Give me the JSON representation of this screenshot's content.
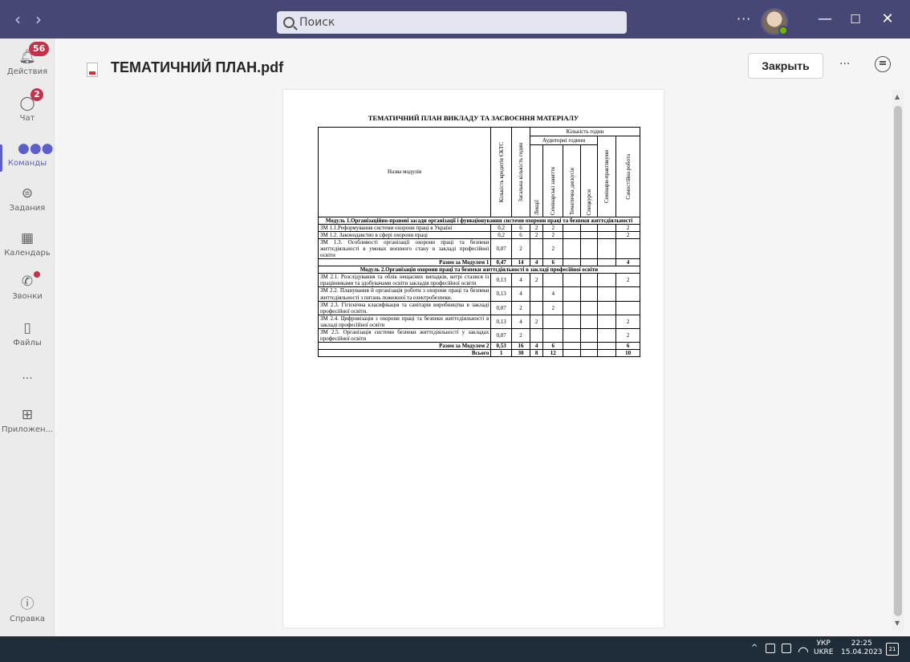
{
  "search": {
    "placeholder": "Поиск"
  },
  "rail": [
    {
      "label": "Действия",
      "badge": "56"
    },
    {
      "label": "Чат",
      "badge": "2"
    },
    {
      "label": "Команды"
    },
    {
      "label": "Задания"
    },
    {
      "label": "Календарь"
    },
    {
      "label": "Звонки"
    },
    {
      "label": "Файлы"
    },
    {
      "label": "..."
    },
    {
      "label": "Приложен..."
    },
    {
      "label": "Справка"
    }
  ],
  "header": {
    "title": "ТЕМАТИЧНИЙ ПЛАН.pdf",
    "close_label": "Закрыть"
  },
  "document": {
    "heading": "ТЕМАТИЧНИЙ ПЛАН ВИКЛАДУ ТА ЗАСВОЄННЯ МАТЕРІАЛУ",
    "col_name": "Назва модулів",
    "col_credits": "Кількість кредитів ЄКТС",
    "col_total": "Загальна кількість годин",
    "col_hours": "Кількість годин",
    "col_aud": "Аудиторні години",
    "col_lect": "Лекції",
    "col_sem": "Семінарські заняття",
    "col_disc": "Тематична дискусія",
    "col_spec": "Спецкурси",
    "col_practicum": "Семінари-практикуми",
    "col_self": "Самостійна робота",
    "module1": "Модуль 1.Організаційно-правові засади організації і функціонування системи охорони праці та безпеки життєдіяльності",
    "m1_rows": [
      {
        "name": "ЗМ 1.1.Реформування системи охорони праці в Україні",
        "cr": "0,2",
        "tot": "6",
        "lec": "2",
        "sem": "2",
        "self": "2"
      },
      {
        "name": "ЗМ 1.2. Законодавство в сфері охорони праці",
        "cr": "0,2",
        "tot": "6",
        "lec": "2",
        "sem": "2",
        "self": "2"
      },
      {
        "name": "ЗМ 1.3. Особливості організації охорони праці та безпеки життєдіяльності в умовах воєнного стану в закладі професійної освіти",
        "cr": "0,07",
        "tot": "2",
        "lec": "",
        "sem": "2",
        "self": ""
      }
    ],
    "m1_total": {
      "label": "Разом за Модулем 1",
      "cr": "0,47",
      "tot": "14",
      "lec": "4",
      "sem": "6",
      "self": "4"
    },
    "module2": "Модуль 2.Організація охорони праці та безпеки життєдіяльності в закладі професійної освіти",
    "m2_rows": [
      {
        "name": "ЗМ 2.1. Розслідування та облік нещасних випадків, котрі сталися із працівниками та здобувачами освіти закладів професійної освіти",
        "cr": "0,13",
        "tot": "4",
        "lec": "2",
        "sem": "",
        "self": "2"
      },
      {
        "name": "ЗМ 2.2. Планування й організація роботи з охорони праці та безпеки життєдіяльності з питань пожежної та електробезпеки.",
        "cr": "0,13",
        "tot": "4",
        "lec": "",
        "sem": "4",
        "self": ""
      },
      {
        "name": "ЗМ 2.3. Гігієнічна класифікація та санітарія виробництва в закладі професійної освіти.",
        "cr": "0,07",
        "tot": "2",
        "lec": "",
        "sem": "2",
        "self": ""
      },
      {
        "name": "ЗМ 2.4. Цифровізація з охорони праці та безпеки життєдіяльності в закладі професійної освіти",
        "cr": "0,13",
        "tot": "4",
        "lec": "2",
        "sem": "",
        "self": "2"
      },
      {
        "name": "ЗМ 2.5. Організація системи безпеки життєдіяльності у закладах професійної освіти",
        "cr": "0,07",
        "tot": "2",
        "lec": "",
        "sem": "",
        "self": "2"
      }
    ],
    "m2_total": {
      "label": "Разом за Модулем 2",
      "cr": "0,53",
      "tot": "16",
      "lec": "4",
      "sem": "6",
      "self": "6"
    },
    "grand_total": {
      "label": "Всього",
      "cr": "1",
      "tot": "30",
      "lec": "8",
      "sem": "12",
      "self": "10"
    }
  },
  "taskbar": {
    "lang_top": "УКР",
    "lang_bottom": "UKRE",
    "time": "22:25",
    "date": "15.04.2023",
    "notif": "21"
  }
}
